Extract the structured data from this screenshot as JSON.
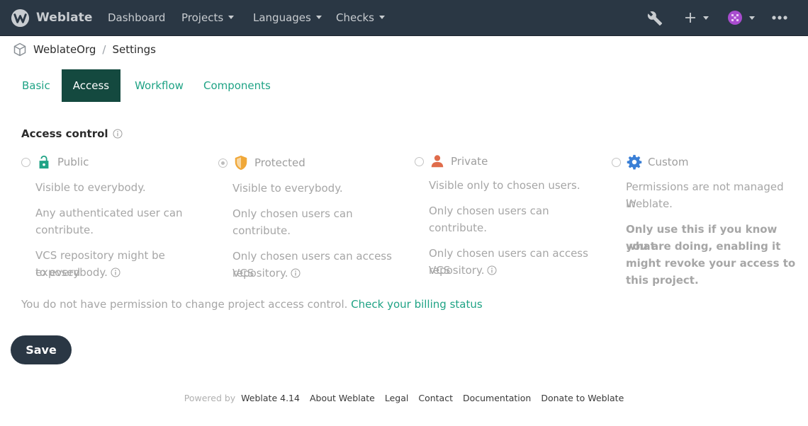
{
  "navbar": {
    "brand": "Weblate",
    "links": [
      {
        "label": "Dashboard"
      },
      {
        "label": "Projects"
      },
      {
        "label": "Languages"
      },
      {
        "label": "Checks"
      }
    ]
  },
  "breadcrumb": {
    "project": "WeblateOrg",
    "separator": "/",
    "page": "Settings"
  },
  "tabs": [
    {
      "label": "Basic"
    },
    {
      "label": "Access"
    },
    {
      "label": "Workflow"
    },
    {
      "label": "Components"
    }
  ],
  "access_control": {
    "title": "Access control",
    "options": [
      {
        "title": "Public",
        "icon": "lock-open-icon",
        "checked": false,
        "lines": [
          "Visible to everybody.",
          "Any authenticated user can",
          "contribute.",
          "VCS repository might be exposed",
          "to everybody."
        ]
      },
      {
        "title": "Protected",
        "icon": "shield-icon",
        "checked": true,
        "lines": [
          "Visible to everybody.",
          "Only chosen users can",
          "contribute.",
          "Only chosen users can access VCS",
          "repository."
        ]
      },
      {
        "title": "Private",
        "icon": "person-icon",
        "checked": false,
        "lines": [
          "Visible only to chosen users.",
          "Only chosen users can",
          "contribute.",
          "Only chosen users can access VCS",
          "repository."
        ]
      },
      {
        "title": "Custom",
        "icon": "gear-icon",
        "checked": false,
        "lines": [
          "Permissions are not managed in",
          "Weblate."
        ],
        "warning_lines": [
          "Only use this if you know what",
          "you are doing, enabling it",
          "might revoke your access to",
          "this project."
        ]
      }
    ],
    "permission_note": "You do not have permission to change project access control.",
    "billing_link": "Check your billing status"
  },
  "save_label": "Save",
  "footer": {
    "powered_by": "Powered by",
    "links": [
      "Weblate 4.14",
      "About Weblate",
      "Legal",
      "Contact",
      "Documentation",
      "Donate to Weblate"
    ]
  },
  "colors": {
    "navbar": "#2a3744",
    "accent": "#1fa385",
    "active_tab": "#14493f",
    "public_icon": "#1fa385",
    "protected_icon": "#f0a839",
    "private_icon": "#e06c4b",
    "custom_icon": "#3a7fd6"
  }
}
